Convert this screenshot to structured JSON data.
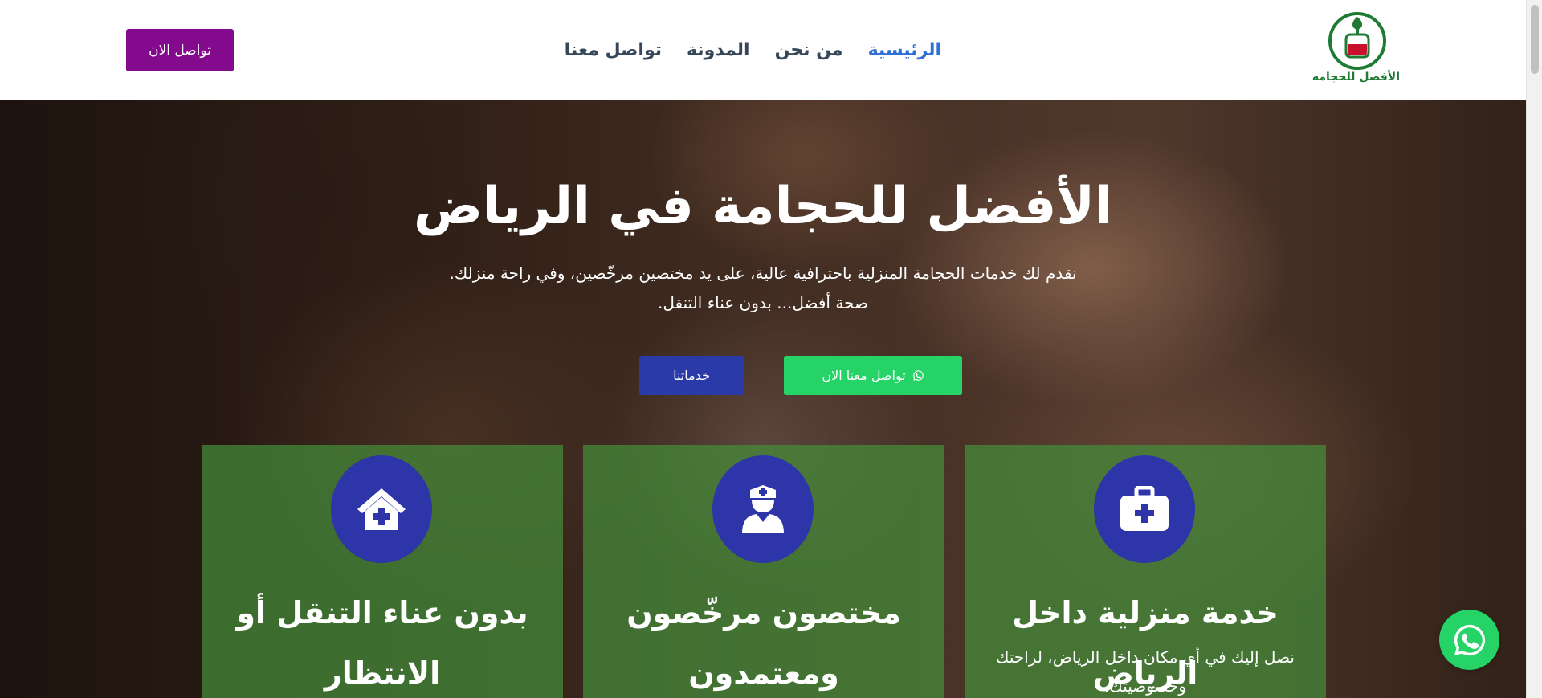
{
  "header": {
    "logo_text": "الأفضل للحجامه",
    "cta_label": "تواصل الان",
    "nav": [
      {
        "label": "الرئيسية",
        "active": true
      },
      {
        "label": "من نحن",
        "active": false
      },
      {
        "label": "المدونة",
        "active": false
      },
      {
        "label": "تواصل معنا",
        "active": false
      }
    ]
  },
  "hero": {
    "title": "الأفضل للحجامة في الرياض",
    "desc_line1": "نقدم لك خدمات الحجامة المنزلية باحترافية عالية، على يد مختصين مرخّصين، وفي راحة منزلك.",
    "desc_line2": "صحة أفضل... بدون عناء التنقل.",
    "whatsapp_button": "تواصل معنا الان",
    "services_button": "خدماتنا"
  },
  "features": [
    {
      "icon": "first-aid-kit-icon",
      "title": "خدمة منزلية داخل الرياض",
      "desc": "نصل إليك في أي مكان داخل الرياض، لراحتك وخصوصيتك."
    },
    {
      "icon": "nurse-icon",
      "title": "مختصون مرخّصون ومعتمدون",
      "desc": ""
    },
    {
      "icon": "home-medical-icon",
      "title": "بدون عناء التنقل أو الانتظار",
      "desc": ""
    }
  ],
  "colors": {
    "accent_purple": "#830a8c",
    "nav_active": "#2f6fd6",
    "whatsapp_green": "#25d366",
    "button_blue": "#2a3aa8",
    "card_green": "#448e3a"
  },
  "icons": {
    "whatsapp_float": "whatsapp-icon",
    "whatsapp_button": "whatsapp-icon"
  }
}
